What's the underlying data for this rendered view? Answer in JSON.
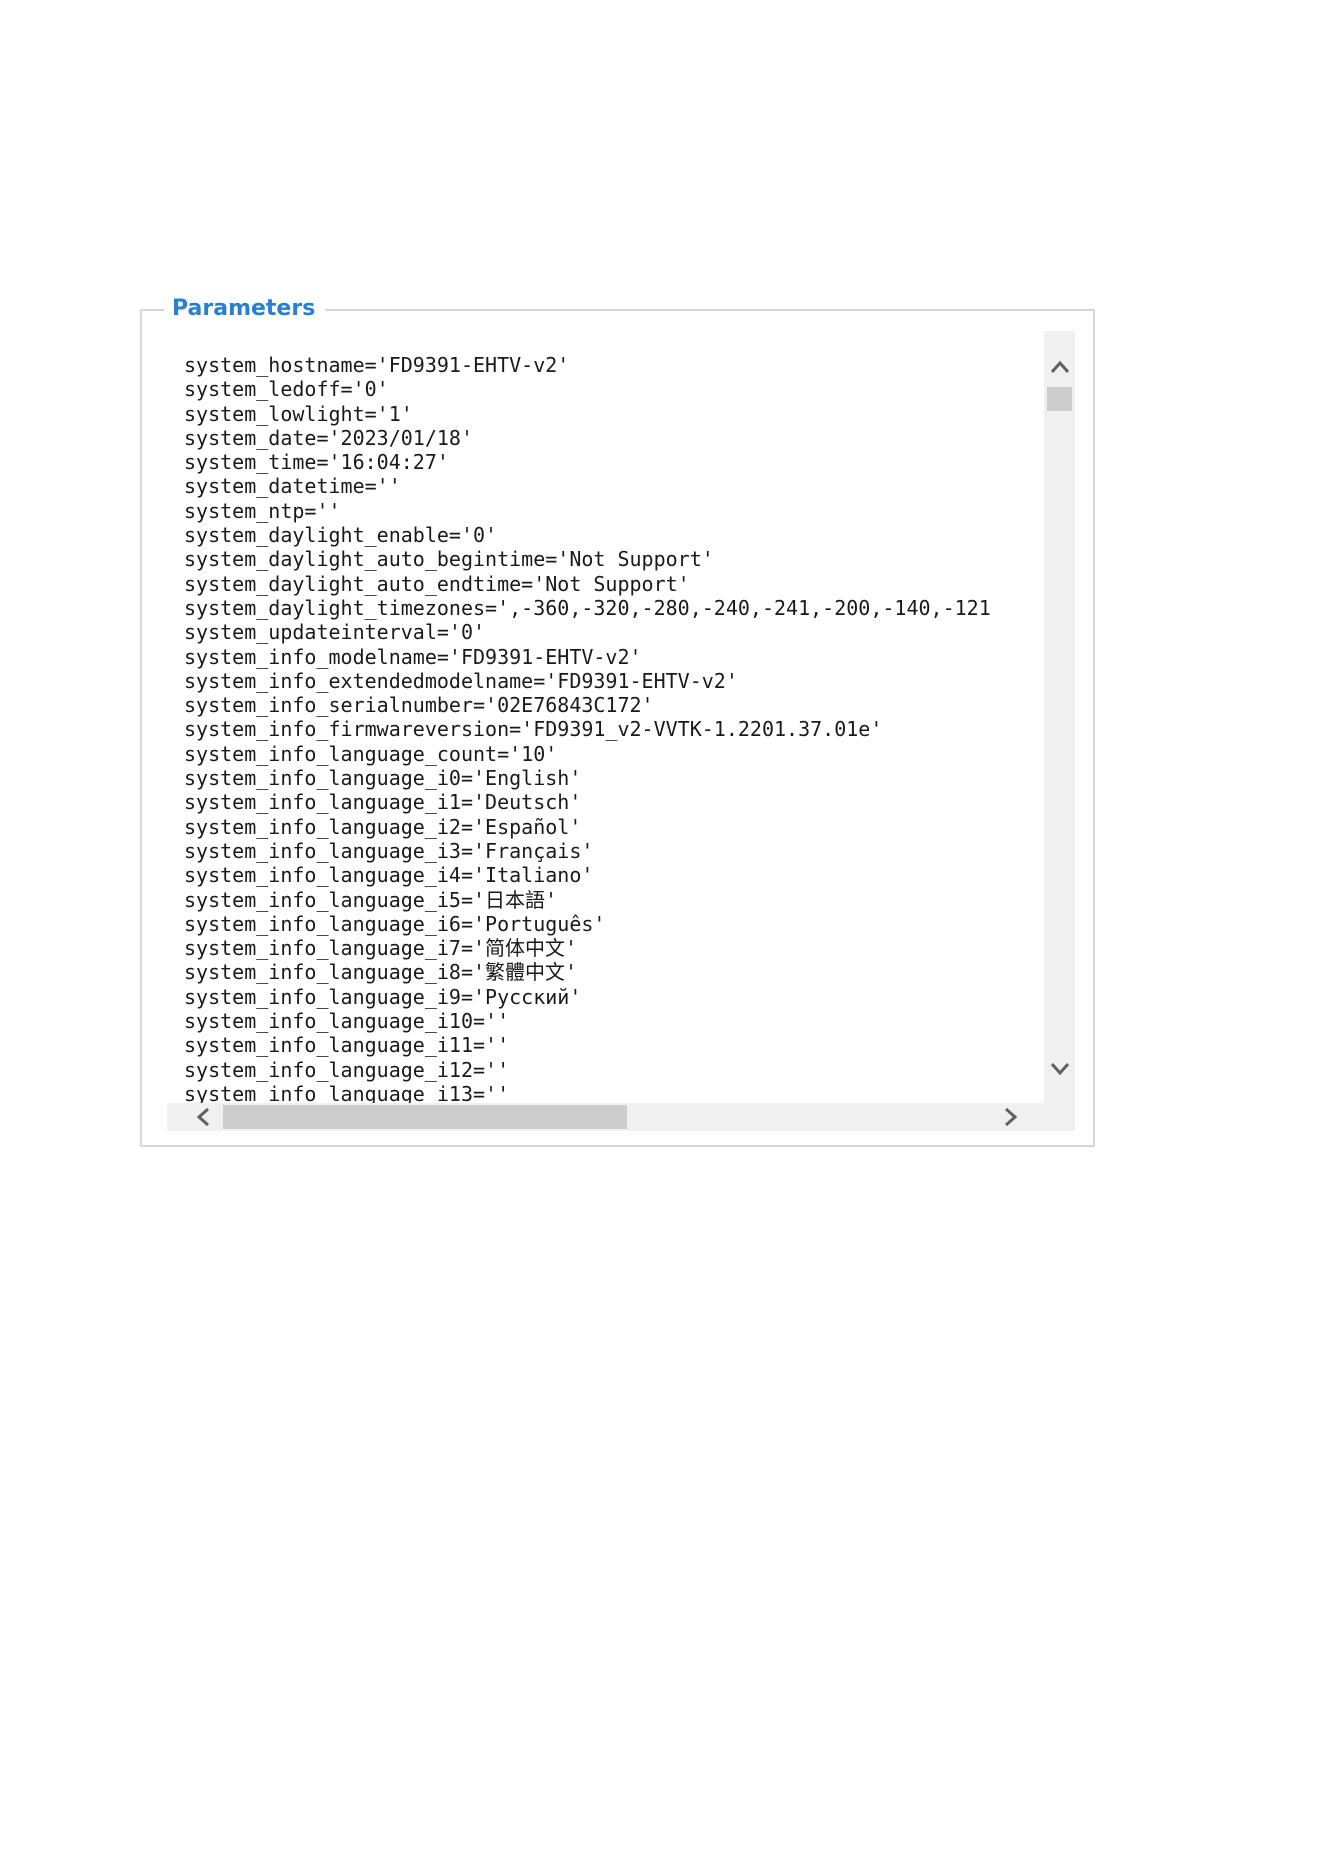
{
  "panel": {
    "title": "Parameters"
  },
  "lines": [
    "system_hostname='FD9391-EHTV-v2'",
    "system_ledoff='0'",
    "system_lowlight='1'",
    "system_date='2023/01/18'",
    "system_time='16:04:27'",
    "system_datetime=''",
    "system_ntp=''",
    "system_daylight_enable='0'",
    "system_daylight_auto_begintime='Not Support'",
    "system_daylight_auto_endtime='Not Support'",
    "system_daylight_timezones=',-360,-320,-280,-240,-241,-200,-140,-121",
    "system_updateinterval='0'",
    "system_info_modelname='FD9391-EHTV-v2'",
    "system_info_extendedmodelname='FD9391-EHTV-v2'",
    "system_info_serialnumber='02E76843C172'",
    "system_info_firmwareversion='FD9391_v2-VVTK-1.2201.37.01e'",
    "system_info_language_count='10'",
    "system_info_language_i0='English'",
    "system_info_language_i1='Deutsch'",
    "system_info_language_i2='Español'",
    "system_info_language_i3='Français'",
    "system_info_language_i4='Italiano'",
    "system_info_language_i5='日本語'",
    "system_info_language_i6='Português'",
    "system_info_language_i7='简体中文'",
    "system_info_language_i8='繁體中文'",
    "system_info_language_i9='Русский'",
    "system_info_language_i10=''",
    "system_info_language_i11=''",
    "system_info_language_i12=''",
    "system_info_language_i13=''"
  ],
  "icons": {
    "up": "chevron-up-icon",
    "down": "chevron-down-icon",
    "left": "chevron-left-icon",
    "right": "chevron-right-icon"
  }
}
